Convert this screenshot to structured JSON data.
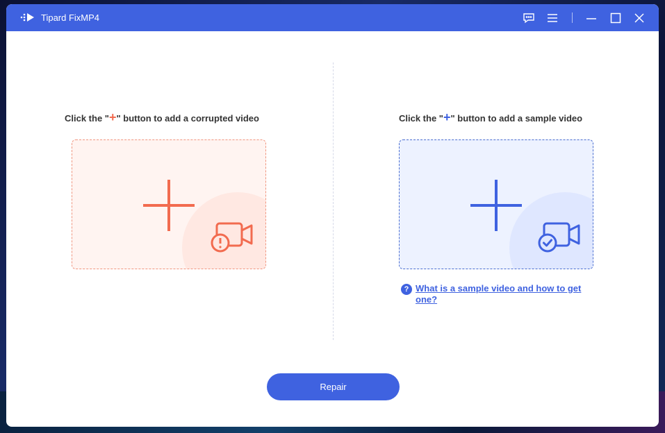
{
  "app": {
    "title": "Tipard FixMP4"
  },
  "titlebar": {
    "icons": [
      "feedback-icon",
      "menu-icon",
      "minimize-icon",
      "maximize-icon",
      "close-icon"
    ]
  },
  "left_panel": {
    "prefix": "Click the \"",
    "plus": "+",
    "suffix": "\" button to add a corrupted video",
    "accent_color": "#f26b4f",
    "icon": "video-warning-icon"
  },
  "right_panel": {
    "prefix": "Click the \"",
    "plus": "+",
    "suffix": "\" button to add a sample video",
    "accent_color": "#3f62e0",
    "icon": "video-check-icon"
  },
  "help": {
    "icon_glyph": "?",
    "link_text": "What is a sample video and how to get one?"
  },
  "repair": {
    "label": "Repair"
  },
  "colors": {
    "titlebar": "#3f62e0",
    "accent_red": "#f26b4f",
    "accent_blue": "#3f62e0"
  }
}
